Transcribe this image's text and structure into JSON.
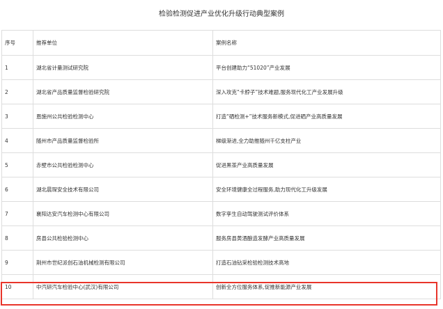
{
  "title": "检验检测促进产业优化升级行动典型案例",
  "table": {
    "headers": {
      "no": "序号",
      "unit": "推荐单位",
      "case": "案例名称"
    },
    "rows": [
      {
        "no": "1",
        "unit": "湖北省计量测试研究院",
        "case": "平台创建助力“51020”产业发展"
      },
      {
        "no": "2",
        "unit": "湖北省产品质量监督检验研究院",
        "case": "深入攻克“卡脖子”技术难题,服务现代化工产业发展升级"
      },
      {
        "no": "3",
        "unit": "恩施州公共检验检测中心",
        "case": "打造“硒检测+”技术服务新模式,促进硒产业高质量发展"
      },
      {
        "no": "4",
        "unit": "随州市产品质量监督检验所",
        "case": "梯级渐进,全力助推随州千亿支柱产业"
      },
      {
        "no": "5",
        "unit": "赤壁市公共检验检测中心",
        "case": "促进黑茶产业高质量发展"
      },
      {
        "no": "6",
        "unit": "湖北晨琛安全技术有限公司",
        "case": "安全环境健康全过程服务,助力现代化工升级发展"
      },
      {
        "no": "7",
        "unit": "襄阳达安汽车检测中心有限公司",
        "case": "数字孪生自动驾驶测试评价体系"
      },
      {
        "no": "8",
        "unit": "房县公共检验检测中心",
        "case": "服务房县黄酒酿造发酵产业高质量发展"
      },
      {
        "no": "9",
        "unit": "荆州市世纪派创石油机械检测有限公司",
        "case": "打造石油钻采检验检测技术高地"
      },
      {
        "no": "10",
        "unit": "中汽研汽车检验中心(武汉)有限公司",
        "case": "创新全方位服务体系,促推新能源产业发展"
      }
    ]
  },
  "highlight": {
    "row_no": "10",
    "color": "#e8342a"
  },
  "colors": {
    "text": "#333333",
    "border": "#dddddd",
    "background": "#ffffff"
  }
}
